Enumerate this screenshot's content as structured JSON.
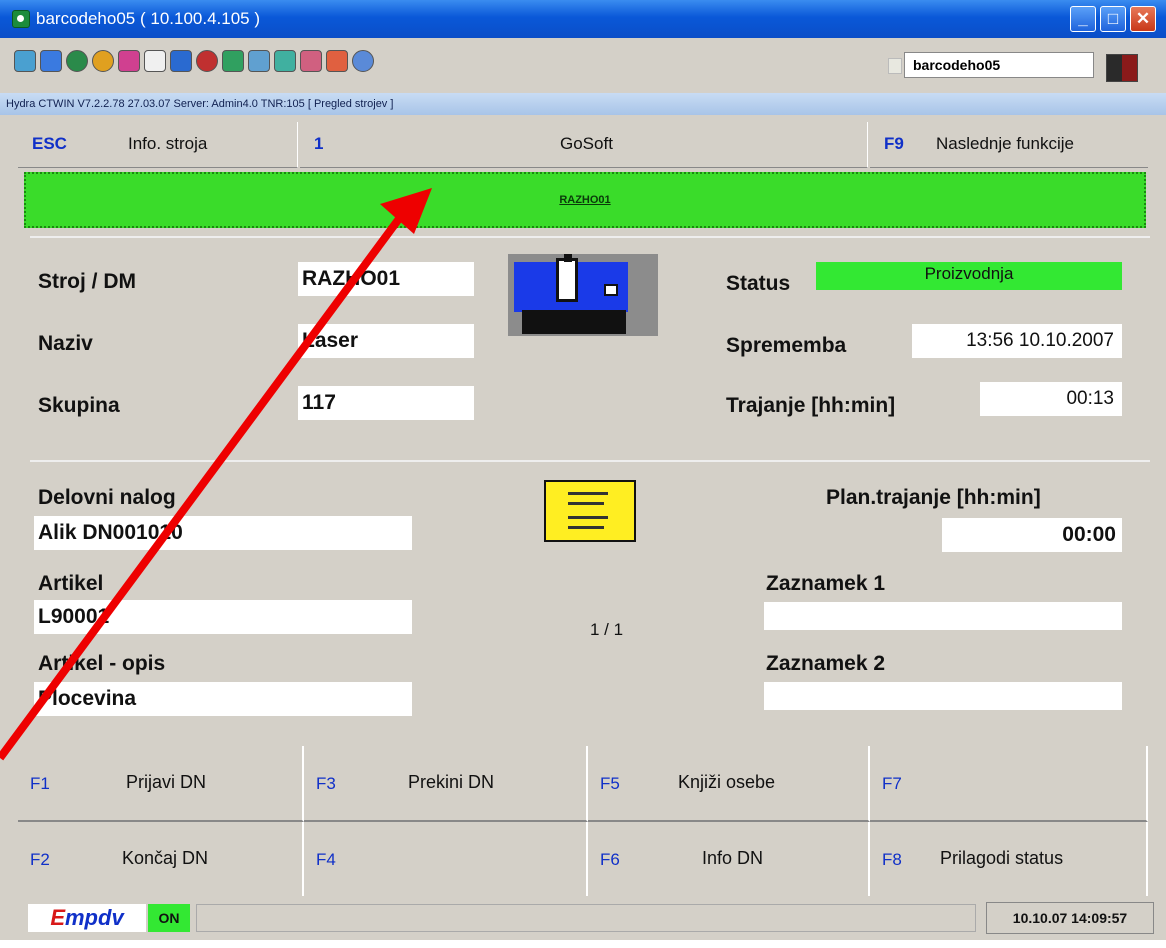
{
  "titlebar": {
    "title": "barcodeho05 ( 10.100.4.105 )"
  },
  "toolbar": {
    "user": "barcodeho05"
  },
  "infobar": {
    "text": "Hydra CTWIN  V7.2.2.78   27.03.07   Server: Admin4.0  TNR:105  [ Pregled strojev ]"
  },
  "funcbar": {
    "esc_key": "ESC",
    "esc_label": "Info. stroja",
    "key1": "1",
    "center_label": "GoSoft",
    "f9_key": "F9",
    "f9_label": "Naslednje funkcije"
  },
  "banner": {
    "text": "RAZHO01"
  },
  "machine": {
    "stroj_label": "Stroj / DM",
    "stroj_value": "RAZHO01",
    "naziv_label": "Naziv",
    "naziv_value": "Laser",
    "skupina_label": "Skupina",
    "skupina_value": "117",
    "status_label": "Status",
    "status_value": "Proizvodnja",
    "sprememba_label": "Sprememba",
    "sprememba_value": "13:56  10.10.2007",
    "trajanje_label": "Trajanje [hh:min]",
    "trajanje_value": "00:13"
  },
  "order": {
    "delovni_label": "Delovni nalog",
    "delovni_value": "Alik  DN001010",
    "artikel_label": "Artikel",
    "artikel_value": "L90001",
    "opis_label": "Artikel - opis",
    "opis_value": "Plocevina",
    "plan_label": "Plan.trajanje  [hh:min]",
    "plan_value": "00:00",
    "z1_label": "Zaznamek 1",
    "z1_value": "",
    "z2_label": "Zaznamek 2",
    "z2_value": "",
    "page": "1 / 1"
  },
  "fkeys": [
    {
      "key": "F1",
      "label": "Prijavi DN"
    },
    {
      "key": "F3",
      "label": "Prekini DN"
    },
    {
      "key": "F5",
      "label": "Knjiži osebe"
    },
    {
      "key": "F7",
      "label": ""
    },
    {
      "key": "F2",
      "label": "Končaj DN"
    },
    {
      "key": "F4",
      "label": ""
    },
    {
      "key": "F6",
      "label": "Info DN"
    },
    {
      "key": "F8",
      "label": "Prilagodi status"
    }
  ],
  "statusbar": {
    "logo_e": "E",
    "logo_rest": "mpdv",
    "on": "ON",
    "datetime": "10.10.07 14:09:57"
  },
  "colors": {
    "annotation_arrow": "#ee0000",
    "status_green": "#33e833",
    "banner_green": "#3adc2a",
    "key_blue": "#1030c8"
  }
}
